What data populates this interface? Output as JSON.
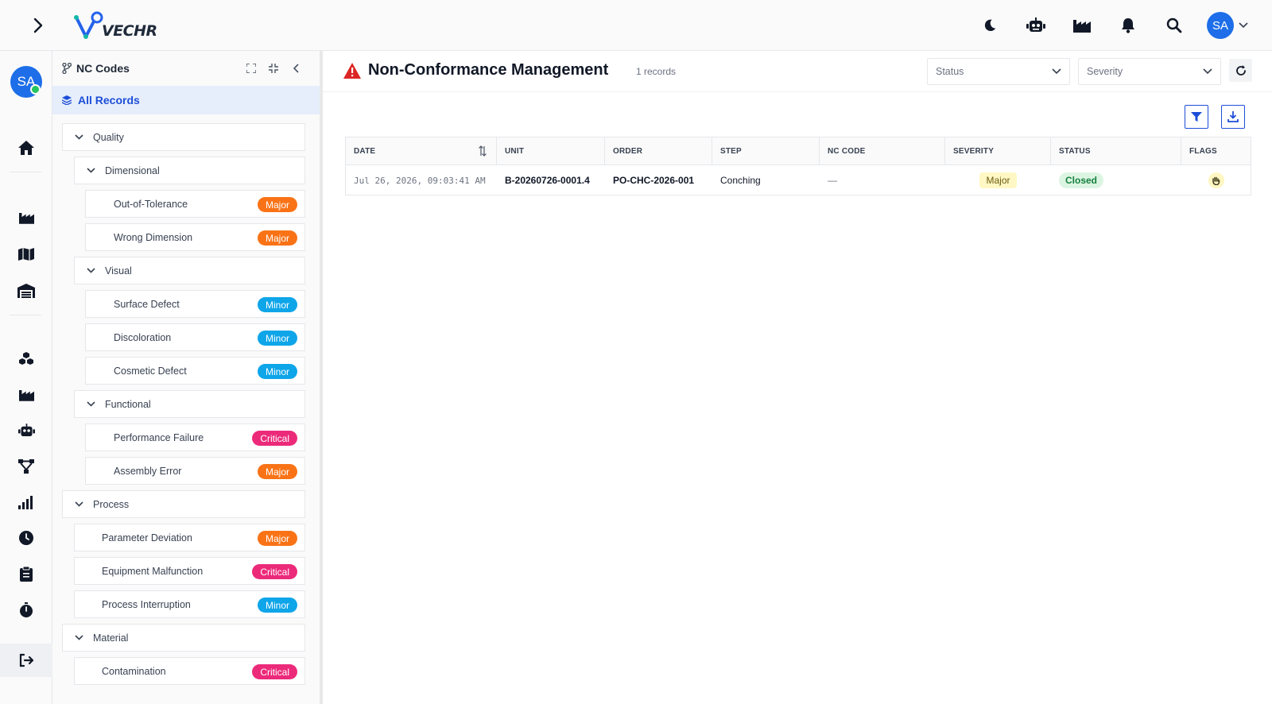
{
  "app": {
    "logo_text": "VECHR"
  },
  "topbar": {
    "icons": [
      "moon-icon",
      "robot-icon",
      "factory-icon",
      "bell-icon",
      "search-icon"
    ],
    "avatar_initials": "SA"
  },
  "rail": {
    "avatar_initials": "SA",
    "items": [
      "home-icon",
      "factory-icon",
      "map-icon",
      "warehouse-icon",
      "cubes-icon",
      "factory-icon",
      "robot-icon",
      "network-icon",
      "signal-icon",
      "clock-icon",
      "clipboard-icon",
      "stopwatch-icon"
    ],
    "logout_icon": "logout-icon"
  },
  "panel": {
    "title": "NC Codes",
    "all_records": "All Records",
    "tree": [
      {
        "label": "Quality",
        "level": 0,
        "type": "group"
      },
      {
        "label": "Dimensional",
        "level": 1,
        "type": "group"
      },
      {
        "label": "Out-of-Tolerance",
        "level": 2,
        "type": "leaf",
        "severity": "Major"
      },
      {
        "label": "Wrong Dimension",
        "level": 2,
        "type": "leaf",
        "severity": "Major"
      },
      {
        "label": "Visual",
        "level": 1,
        "type": "group"
      },
      {
        "label": "Surface Defect",
        "level": 2,
        "type": "leaf",
        "severity": "Minor"
      },
      {
        "label": "Discoloration",
        "level": 2,
        "type": "leaf",
        "severity": "Minor"
      },
      {
        "label": "Cosmetic Defect",
        "level": 2,
        "type": "leaf",
        "severity": "Minor"
      },
      {
        "label": "Functional",
        "level": 1,
        "type": "group"
      },
      {
        "label": "Performance Failure",
        "level": 2,
        "type": "leaf",
        "severity": "Critical"
      },
      {
        "label": "Assembly Error",
        "level": 2,
        "type": "leaf",
        "severity": "Major"
      },
      {
        "label": "Process",
        "level": 0,
        "type": "group"
      },
      {
        "label": "Parameter Deviation",
        "level": 1,
        "type": "leaf",
        "severity": "Major"
      },
      {
        "label": "Equipment Malfunction",
        "level": 1,
        "type": "leaf",
        "severity": "Critical"
      },
      {
        "label": "Process Interruption",
        "level": 1,
        "type": "leaf",
        "severity": "Minor"
      },
      {
        "label": "Material",
        "level": 0,
        "type": "group"
      },
      {
        "label": "Contamination",
        "level": 1,
        "type": "leaf",
        "severity": "Critical"
      }
    ],
    "severity_colors": {
      "Major": "#f97316",
      "Minor": "#0ea5e9",
      "Critical": "#ec2a7a"
    }
  },
  "main": {
    "title": "Non-Conformance Management",
    "record_count": "1 records",
    "status_placeholder": "Status",
    "severity_placeholder": "Severity",
    "table": {
      "columns": [
        "DATE",
        "UNIT",
        "ORDER",
        "STEP",
        "NC CODE",
        "SEVERITY",
        "STATUS",
        "FLAGS"
      ],
      "rows": [
        {
          "date": "Jul 26, 2026, 09:03:41 AM",
          "unit": "B-20260726-0001.4",
          "order": "PO-CHC-2026-001",
          "step": "Conching",
          "nc_code": "—",
          "severity": "Major",
          "status": "Closed",
          "flag_icon": "hand-icon"
        }
      ]
    }
  },
  "colors": {
    "accent": "#1d4ed8",
    "avatar": "#1d6ee8",
    "online": "#22c55e",
    "warning": "#dc2626"
  }
}
